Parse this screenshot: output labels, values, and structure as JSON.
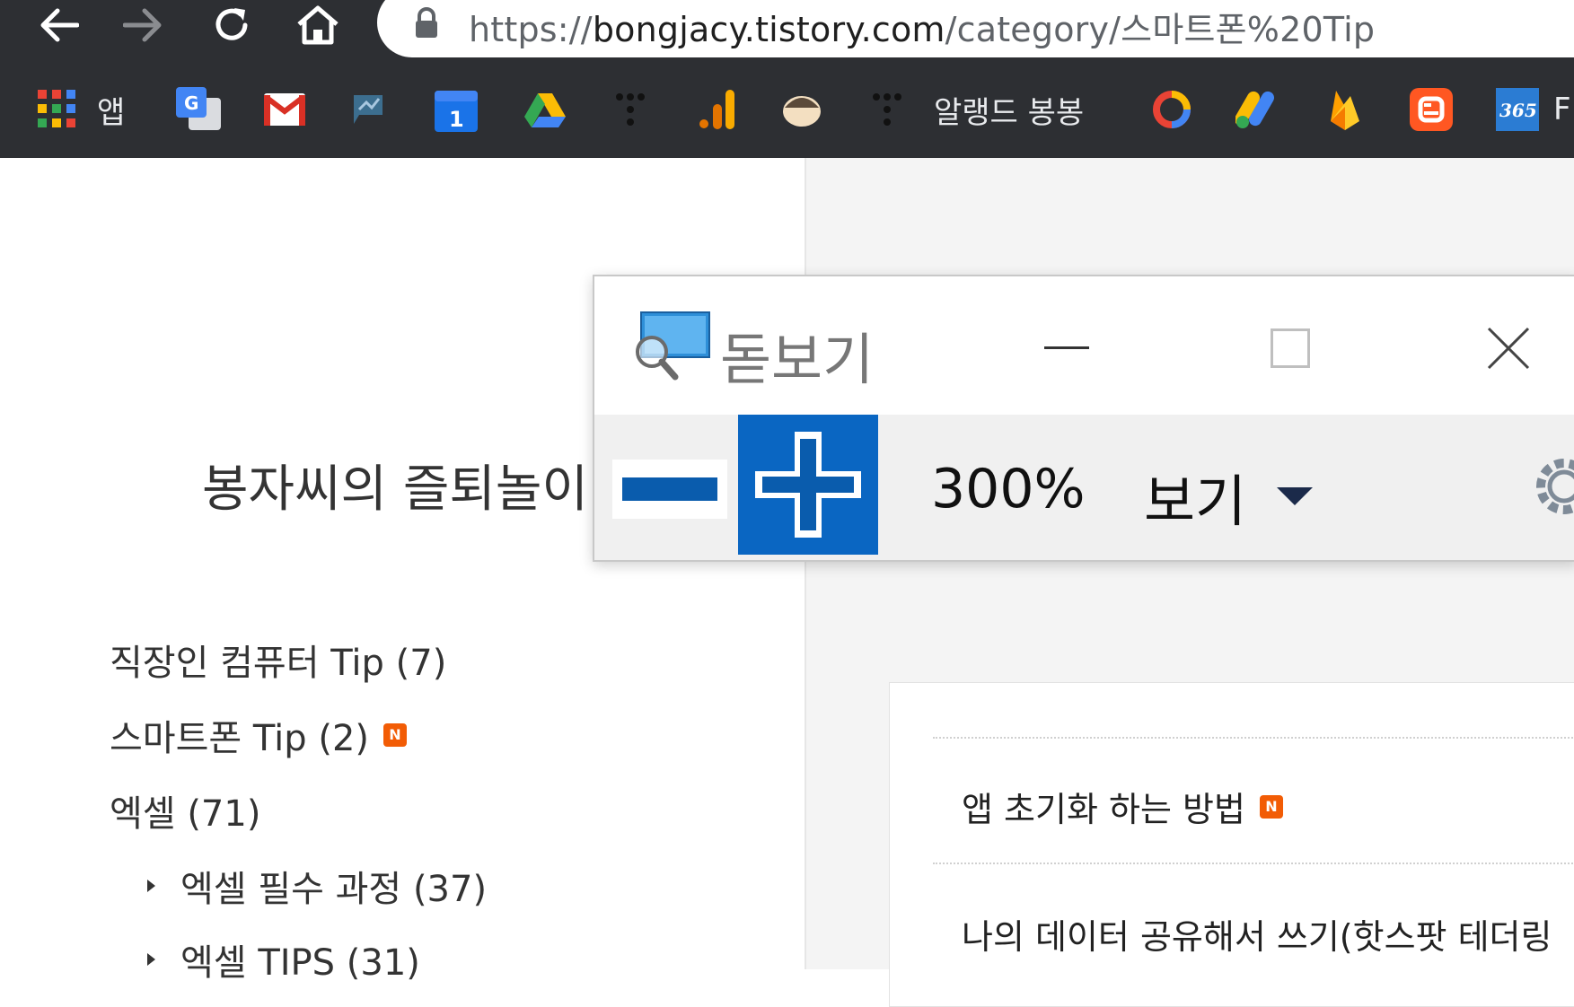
{
  "browser": {
    "url_scheme": "https://",
    "url_host": "bongjacy.tistory.com",
    "url_path": "/category/스마트폰%20Tip",
    "bookmarks": [
      {
        "label": "앱",
        "icon": "apps-grid-icon"
      },
      {
        "label": "",
        "icon": "google-translate-icon"
      },
      {
        "label": "",
        "icon": "gmail-icon"
      },
      {
        "label": "",
        "icon": "analytics-flag-icon"
      },
      {
        "label": "",
        "icon": "calendar-icon"
      },
      {
        "label": "",
        "icon": "google-drive-icon"
      },
      {
        "label": "",
        "icon": "dots-icon"
      },
      {
        "label": "",
        "icon": "google-analytics-icon"
      },
      {
        "label": "",
        "icon": "face-icon"
      },
      {
        "label": "알랭드 봉봉",
        "icon": "dots-icon"
      },
      {
        "label": "",
        "icon": "ring-icon"
      },
      {
        "label": "",
        "icon": "google-ads-icon"
      },
      {
        "label": "",
        "icon": "firebase-icon"
      },
      {
        "label": "",
        "icon": "blogger-icon"
      },
      {
        "label": "",
        "icon": "office365-icon"
      },
      {
        "label": "F",
        "icon": ""
      }
    ],
    "calendar_day": "1"
  },
  "blog": {
    "title": "봉자씨의 즐퇴놀이",
    "categories": [
      {
        "label": "직장인 컴퓨터 Tip (7)",
        "new": false,
        "sub": false
      },
      {
        "label": "스마트폰 Tip (2)",
        "new": true,
        "sub": false
      },
      {
        "label": "엑셀 (71)",
        "new": false,
        "sub": false
      },
      {
        "label": "엑셀 필수 과정 (37)",
        "new": false,
        "sub": true
      },
      {
        "label": "엑셀 TIPS (31)",
        "new": false,
        "sub": true
      }
    ],
    "new_badge": "N",
    "posts": [
      {
        "title": "앱 초기화 하는 방법",
        "new": true
      },
      {
        "title": "나의 데이터 공유해서 쓰기(핫스팟 테더링",
        "new": false
      }
    ]
  },
  "magnifier": {
    "title": "돋보기",
    "zoom_level": "300%",
    "view_label": "보기"
  },
  "colors": {
    "chrome_dark": "#2d2f33",
    "magnifier_blue": "#0a66c2",
    "new_badge": "#f25c05"
  }
}
